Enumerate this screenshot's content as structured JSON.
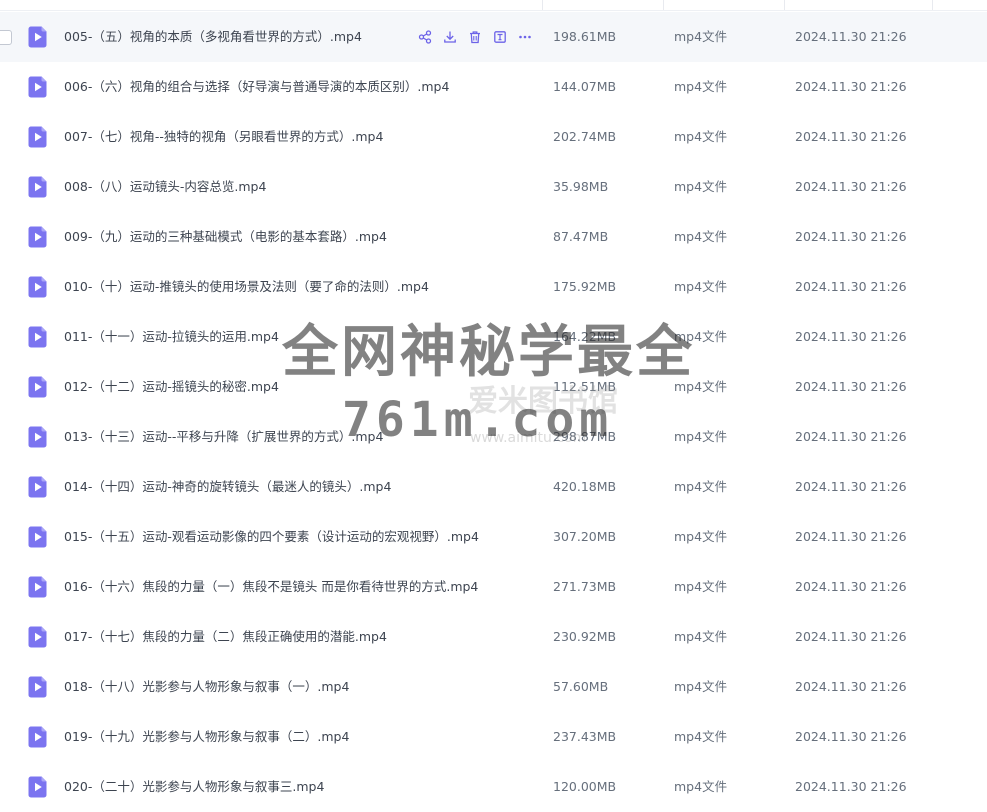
{
  "accent_color": "#7b74f0",
  "files": [
    {
      "name": "005-（五）视角的本质（多视角看世界的方式）.mp4",
      "size": "198.61MB",
      "type": "mp4文件",
      "time": "2024.11.30 21:26"
    },
    {
      "name": "006-（六）视角的组合与选择（好导演与普通导演的本质区别）.mp4",
      "size": "144.07MB",
      "type": "mp4文件",
      "time": "2024.11.30 21:26"
    },
    {
      "name": "007-（七）视角--独特的视角（另眼看世界的方式）.mp4",
      "size": "202.74MB",
      "type": "mp4文件",
      "time": "2024.11.30 21:26"
    },
    {
      "name": "008-（八）运动镜头-内容总览.mp4",
      "size": "35.98MB",
      "type": "mp4文件",
      "time": "2024.11.30 21:26"
    },
    {
      "name": "009-（九）运动的三种基础模式（电影的基本套路）.mp4",
      "size": "87.47MB",
      "type": "mp4文件",
      "time": "2024.11.30 21:26"
    },
    {
      "name": "010-（十）运动-推镜头的使用场景及法则（要了命的法则）.mp4",
      "size": "175.92MB",
      "type": "mp4文件",
      "time": "2024.11.30 21:26"
    },
    {
      "name": "011-（十一）运动-拉镜头的运用.mp4",
      "size": "164.22MB",
      "type": "mp4文件",
      "time": "2024.11.30 21:26"
    },
    {
      "name": "012-（十二）运动-摇镜头的秘密.mp4",
      "size": "112.51MB",
      "type": "mp4文件",
      "time": "2024.11.30 21:26"
    },
    {
      "name": "013-（十三）运动--平移与升降（扩展世界的方式）.mp4",
      "size": "298.87MB",
      "type": "mp4文件",
      "time": "2024.11.30 21:26"
    },
    {
      "name": "014-（十四）运动-神奇的旋转镜头（最迷人的镜头）.mp4",
      "size": "420.18MB",
      "type": "mp4文件",
      "time": "2024.11.30 21:26"
    },
    {
      "name": "015-（十五）运动-观看运动影像的四个要素（设计运动的宏观视野）.mp4",
      "size": "307.20MB",
      "type": "mp4文件",
      "time": "2024.11.30 21:26"
    },
    {
      "name": "016-（十六）焦段的力量（一）焦段不是镜头 而是你看待世界的方式.mp4",
      "size": "271.73MB",
      "type": "mp4文件",
      "time": "2024.11.30 21:26"
    },
    {
      "name": "017-（十七）焦段的力量（二）焦段正确使用的潜能.mp4",
      "size": "230.92MB",
      "type": "mp4文件",
      "time": "2024.11.30 21:26"
    },
    {
      "name": "018-（十八）光影参与人物形象与叙事（一）.mp4",
      "size": "57.60MB",
      "type": "mp4文件",
      "time": "2024.11.30 21:26"
    },
    {
      "name": "019-（十九）光影参与人物形象与叙事（二）.mp4",
      "size": "237.43MB",
      "type": "mp4文件",
      "time": "2024.11.30 21:26"
    },
    {
      "name": "020-（二十）光影参与人物形象与叙事三.mp4",
      "size": "120.00MB",
      "type": "mp4文件",
      "time": "2024.11.30 21:26"
    }
  ],
  "row_actions": [
    "share-icon",
    "download-icon",
    "delete-icon",
    "rename-icon",
    "more-icon"
  ],
  "watermark": {
    "line1": "全网神秘学最全",
    "line2": "761m.com",
    "line3": "爱米图书馆",
    "line4": "www.aimitu.com"
  }
}
